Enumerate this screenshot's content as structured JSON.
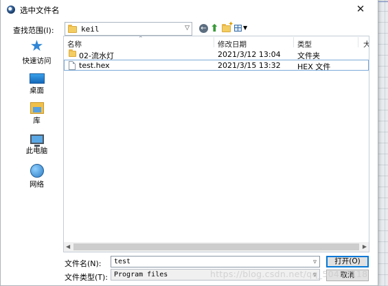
{
  "dialog": {
    "title": "选中文件名",
    "close_glyph": "✕"
  },
  "toolbar": {
    "look_in_label": "查找范围(I):",
    "look_in_value": "keil"
  },
  "places": [
    {
      "label": "快速访问",
      "icon": "quick-access-icon"
    },
    {
      "label": "桌面",
      "icon": "desktop-icon"
    },
    {
      "label": "库",
      "icon": "library-icon"
    },
    {
      "label": "此电脑",
      "icon": "this-pc-icon"
    },
    {
      "label": "网络",
      "icon": "network-icon"
    }
  ],
  "columns": {
    "name": "名称",
    "modified": "修改日期",
    "type": "类型",
    "size": "大"
  },
  "files": [
    {
      "name": "02-流水灯",
      "modified": "2021/3/12 13:04",
      "type": "文件夹",
      "kind": "folder"
    },
    {
      "name": "test.hex",
      "modified": "2021/3/15 13:32",
      "type": "HEX 文件",
      "kind": "file",
      "selected": true
    }
  ],
  "form": {
    "filename_label": "文件名(N):",
    "filename_value": "test",
    "filetype_label": "文件类型(T):",
    "filetype_value": "Program files"
  },
  "buttons": {
    "open": "打开(O)",
    "cancel": "取消"
  },
  "watermark": "https://blog.csdn.net/qq_50459118"
}
